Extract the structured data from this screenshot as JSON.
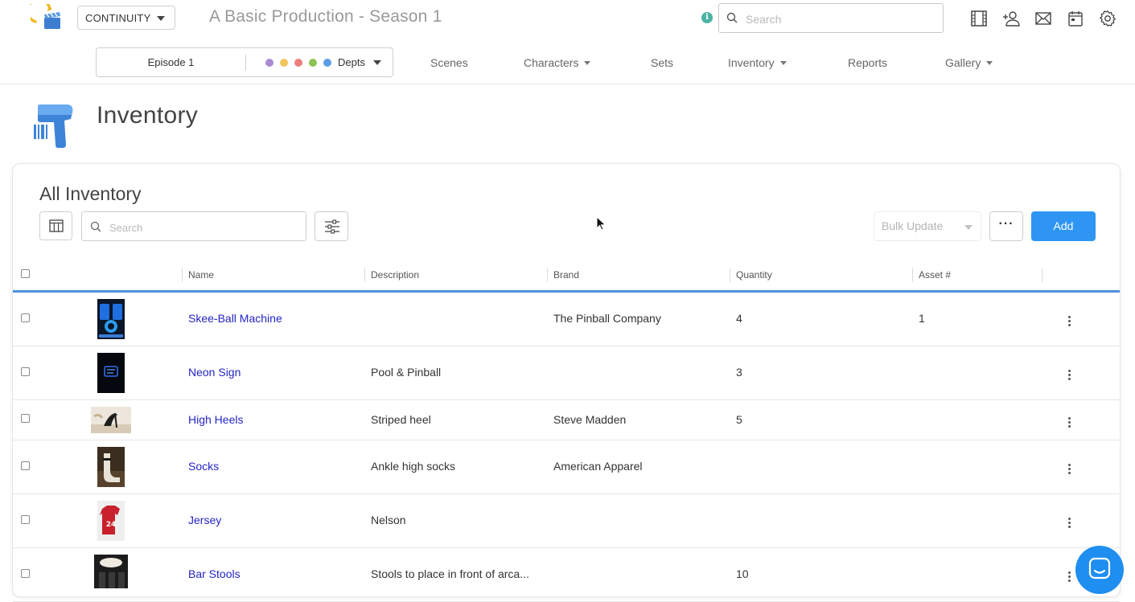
{
  "topbar": {
    "mode": "CONTINUITY",
    "production_title": "A Basic Production - Season 1",
    "info_glyph": "i",
    "search_placeholder": "Search",
    "icons": [
      "film-icon",
      "add-user-icon",
      "mail-icon",
      "calendar-icon",
      "gear-icon"
    ]
  },
  "nav": {
    "episode": "Episode 1",
    "depts_label": "Depts",
    "dept_colors": [
      "#a98bd6",
      "#f2c45c",
      "#ee7d7d",
      "#8dc255",
      "#5b9ee8"
    ],
    "items": [
      {
        "label": "Scenes",
        "dropdown": false
      },
      {
        "label": "Characters",
        "dropdown": true
      },
      {
        "label": "Sets",
        "dropdown": false
      },
      {
        "label": "Inventory",
        "dropdown": true
      },
      {
        "label": "Reports",
        "dropdown": false
      },
      {
        "label": "Gallery",
        "dropdown": true
      }
    ]
  },
  "page": {
    "title": "Inventory"
  },
  "card": {
    "title": "All Inventory",
    "search_placeholder": "Search",
    "bulk_update_label": "Bulk Update",
    "more_label": "···",
    "add_label": "Add"
  },
  "table": {
    "columns": [
      "Name",
      "Description",
      "Brand",
      "Quantity",
      "Asset #"
    ],
    "rows": [
      {
        "name": "Skee-Ball Machine",
        "description": "",
        "brand": "The Pinball Company",
        "quantity": "4",
        "asset": "1",
        "thumb": "arcade"
      },
      {
        "name": "Neon Sign",
        "description": "Pool & Pinball",
        "brand": "",
        "quantity": "3",
        "asset": "",
        "thumb": "neon"
      },
      {
        "name": "High Heels",
        "description": "Striped heel",
        "brand": "Steve Madden",
        "quantity": "5",
        "asset": "",
        "thumb": "heels"
      },
      {
        "name": "Socks",
        "description": "Ankle high socks",
        "brand": "American Apparel",
        "quantity": "",
        "asset": "",
        "thumb": "socks"
      },
      {
        "name": "Jersey",
        "description": "Nelson",
        "brand": "",
        "quantity": "",
        "asset": "",
        "thumb": "jersey",
        "jersey_number": "24"
      },
      {
        "name": "Bar Stools",
        "description": "Stools to place in front of arca...",
        "brand": "",
        "quantity": "10",
        "asset": "",
        "thumb": "stools"
      }
    ]
  },
  "colors": {
    "accent": "#2e96f2",
    "link": "#2424c8",
    "header_rule": "#4e92dc"
  }
}
